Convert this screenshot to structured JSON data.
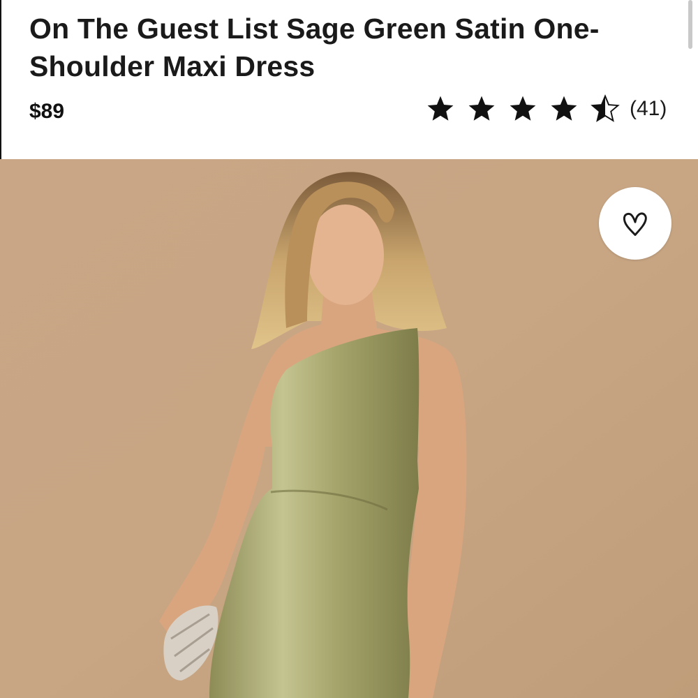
{
  "product": {
    "title": "On The Guest List Sage Green Satin One-Shoulder Maxi Dress",
    "price": "$89",
    "rating": {
      "value": 4.5,
      "max": 5,
      "review_count": "(41)"
    }
  },
  "icons": {
    "full_star": "star-icon",
    "half_star": "half-star-icon",
    "favorite": "heart-icon"
  },
  "colors": {
    "photo_background": "#c8a684",
    "dress": "#a3a26a",
    "star": "#111111"
  }
}
